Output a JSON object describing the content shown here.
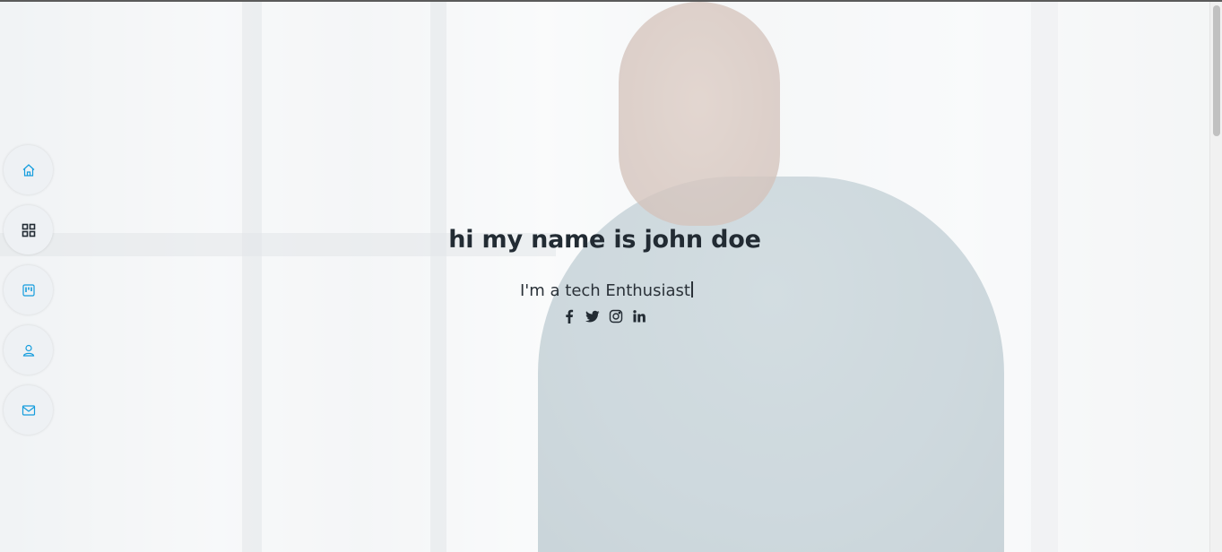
{
  "hero": {
    "title": "hi my name is john doe",
    "subtitle_prefix": "I'm a ",
    "subtitle_typed": "tech Enthusiast"
  },
  "side_nav": {
    "items": [
      {
        "icon": "house-icon"
      },
      {
        "icon": "grid-icon"
      },
      {
        "icon": "kanban-icon"
      },
      {
        "icon": "person-icon"
      },
      {
        "icon": "envelope-icon"
      }
    ],
    "active_index": 1
  },
  "social_links": [
    {
      "icon": "facebook-icon"
    },
    {
      "icon": "twitter-icon"
    },
    {
      "icon": "instagram-icon"
    },
    {
      "icon": "linkedin-icon"
    }
  ],
  "colors": {
    "accent": "#149ddd",
    "heading": "#222b33",
    "nav_bg": "#eef1f4"
  }
}
